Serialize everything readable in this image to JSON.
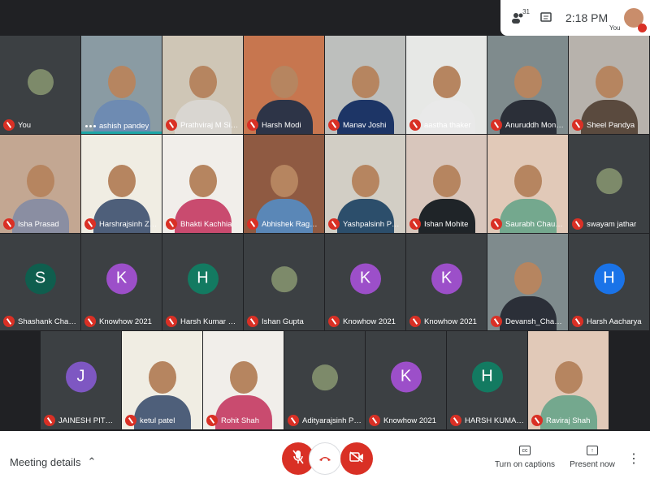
{
  "topbar": {
    "people_icon": "people-icon",
    "participant_count": "31",
    "chat_icon": "chat-icon",
    "time": "2:18 PM",
    "user_label": "You"
  },
  "colors": {
    "background": "#202124",
    "mute_red": "#d93025",
    "active_speaker": "#1ea6a6"
  },
  "tiles": [
    {
      "name": "You",
      "type": "photo-avatar"
    },
    {
      "name": "ashish pandey",
      "type": "video",
      "talking": true
    },
    {
      "name": "Prathviraj M Singh",
      "type": "video"
    },
    {
      "name": "Harsh Modi",
      "type": "video"
    },
    {
      "name": "Manav Joshi",
      "type": "video"
    },
    {
      "name": "aastha thaker",
      "type": "video"
    },
    {
      "name": "Anuruddh Mondal",
      "type": "video"
    },
    {
      "name": "Sheel Pandya",
      "type": "video"
    },
    {
      "name": "Isha Prasad",
      "type": "video"
    },
    {
      "name": "Harshrajsinh Zala",
      "type": "video"
    },
    {
      "name": "Bhakti Kachhia",
      "type": "video"
    },
    {
      "name": "Abhishek Raghuvanshi",
      "type": "video"
    },
    {
      "name": "Yashpalsinh Parmar",
      "type": "video"
    },
    {
      "name": "Ishan Mohite",
      "type": "video"
    },
    {
      "name": "Saurabh Chaurasiya",
      "type": "video"
    },
    {
      "name": "swayam jathar",
      "type": "photo-avatar"
    },
    {
      "name": "Shashank Chaubey",
      "type": "letter",
      "letter": "S",
      "color": "#0f5e4e"
    },
    {
      "name": "Knowhow 2021",
      "type": "letter",
      "letter": "K",
      "color": "#9c4fc9"
    },
    {
      "name": "Harsh Kumar Singh",
      "type": "letter",
      "letter": "H",
      "color": "#137a61"
    },
    {
      "name": "Ishan Gupta",
      "type": "photo-avatar"
    },
    {
      "name": "Knowhow 2021",
      "type": "letter",
      "letter": "K",
      "color": "#9c4fc9"
    },
    {
      "name": "Knowhow 2021",
      "type": "letter",
      "letter": "K",
      "color": "#9c4fc9"
    },
    {
      "name": "Devansh_Chavda",
      "type": "video"
    },
    {
      "name": "Harsh Aacharya",
      "type": "letter",
      "letter": "H",
      "color": "#1a73e8"
    },
    {
      "name": "JAINESH PITHADIYA",
      "type": "letter",
      "letter": "J",
      "color": "#7e57c2"
    },
    {
      "name": "ketul patel",
      "type": "video"
    },
    {
      "name": "Rohit Shah",
      "type": "video"
    },
    {
      "name": "Adityarajsinh Parmar",
      "type": "photo-avatar"
    },
    {
      "name": "Knowhow 2021",
      "type": "letter",
      "letter": "K",
      "color": "#9c4fc9"
    },
    {
      "name": "HARSH KUMAR SINGH",
      "type": "letter",
      "letter": "H",
      "color": "#137a61"
    },
    {
      "name": "Raviraj Shah",
      "type": "video"
    }
  ],
  "bottom": {
    "meeting_details": "Meeting details",
    "meeting_details_icon": "chevron-up-icon",
    "mic_icon": "mic-off-icon",
    "hangup_icon": "call-end-icon",
    "camera_icon": "camera-off-icon",
    "captions_label": "Turn on captions",
    "captions_icon": "cc-icon",
    "present_label": "Present now",
    "present_icon": "present-icon",
    "more_icon": "more-vert-icon"
  }
}
